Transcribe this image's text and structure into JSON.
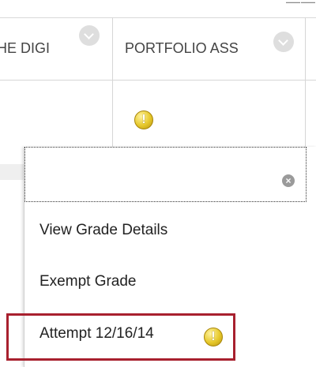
{
  "top_strip": {
    "partial_text": "——"
  },
  "grid": {
    "columns": [
      {
        "header": "HE DIGI"
      },
      {
        "header": "PORTFOLIO ASS"
      }
    ]
  },
  "menu": {
    "items": [
      {
        "label": "View Grade Details"
      },
      {
        "label": "Exempt Grade"
      },
      {
        "label": "Attempt 12/16/14"
      }
    ],
    "search_value": ""
  },
  "colors": {
    "highlight_border": "#a8202e",
    "warning_icon": "#e6c82a",
    "grid_line": "#d6d6d6"
  },
  "icons": {
    "column_menu": "chevron-down-icon",
    "status": "warning-icon",
    "clear": "close-icon"
  }
}
